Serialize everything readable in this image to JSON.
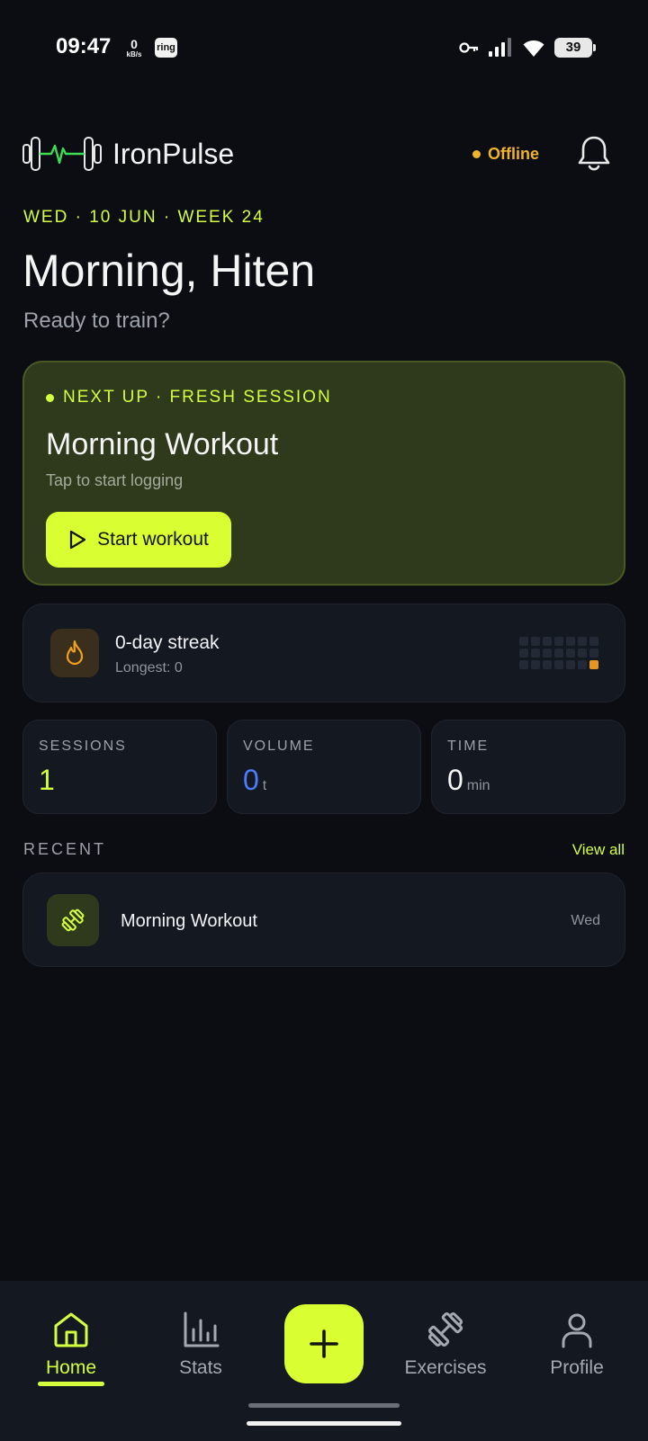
{
  "status_bar": {
    "time": "09:47",
    "net_speed": "0",
    "net_unit": "kB/s",
    "ring_app": "ring",
    "battery": "39"
  },
  "header": {
    "app_name": "IronPulse",
    "connection_status": "Offline",
    "colors": {
      "accent": "#d4ff3f",
      "status": "#f0b429"
    }
  },
  "greeting": {
    "date_line": "WED · 10 JUN · WEEK 24",
    "title": "Morning, Hiten",
    "subtitle": "Ready to train?"
  },
  "next_up": {
    "label": "NEXT UP · FRESH SESSION",
    "title": "Morning Workout",
    "subtitle": "Tap to start logging",
    "button_label": "Start workout"
  },
  "streak": {
    "title": "0-day streak",
    "longest": "Longest: 0",
    "grid_days": 21,
    "active_days": [
      20
    ]
  },
  "stats": [
    {
      "label": "SESSIONS",
      "value": "1",
      "unit": "",
      "color": "#d4ff3f"
    },
    {
      "label": "VOLUME",
      "value": "0",
      "unit": "t",
      "color": "#4d7dff"
    },
    {
      "label": "TIME",
      "value": "0",
      "unit": "min",
      "color": "#f5f5f5"
    }
  ],
  "recent": {
    "heading": "RECENT",
    "view_all": "View all",
    "items": [
      {
        "title": "Morning Workout",
        "day": "Wed"
      }
    ]
  },
  "nav": {
    "items": [
      {
        "label": "Home",
        "icon": "home-icon",
        "active": true
      },
      {
        "label": "Stats",
        "icon": "bar-chart-icon",
        "active": false
      },
      {
        "label": "Exercises",
        "icon": "dumbbell-icon",
        "active": false
      },
      {
        "label": "Profile",
        "icon": "user-icon",
        "active": false
      }
    ],
    "fab_icon": "plus-icon"
  }
}
